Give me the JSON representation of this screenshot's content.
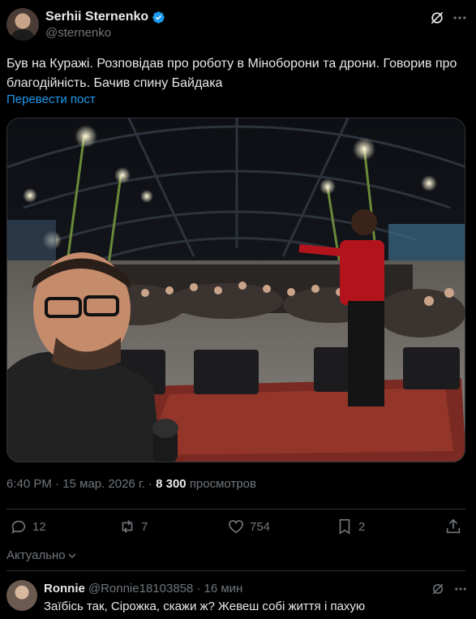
{
  "post": {
    "author_name": "Serhii Sternenko",
    "author_handle": "@sternenko",
    "text": "Був на Куражі. Розповідав про роботу в Міноборони та дрони. Говорив про благодійність. Бачив спину Байдака",
    "translate_label": "Перевести пост",
    "time": "6:40 PM",
    "date": "15 мар. 2026 г.",
    "views_count": "8 300",
    "views_label": "просмотров",
    "separator": "·"
  },
  "actions": {
    "replies": "12",
    "reposts": "7",
    "likes": "754",
    "bookmarks": "2"
  },
  "sort": {
    "label": "Актуально"
  },
  "reply": {
    "author_name": "Ronnie",
    "author_handle": "@Ronnie18103858",
    "time": "· 16 мин",
    "text": "Заїбісь так, Сірожка, скажи ж? Жевеш собі життя і пахую"
  },
  "colors": {
    "accent": "#1d9bf0",
    "background": "#000000",
    "muted": "#71767b",
    "text": "#e7e9ea",
    "divider": "#2f3336"
  },
  "icons": {
    "verified": "verified-badge-icon",
    "grok": "grok-icon",
    "more": "more-icon",
    "reply": "reply-icon",
    "repost": "repost-icon",
    "like": "heart-icon",
    "bookmark": "bookmark-icon",
    "share": "share-icon",
    "chevron": "chevron-down-icon"
  }
}
